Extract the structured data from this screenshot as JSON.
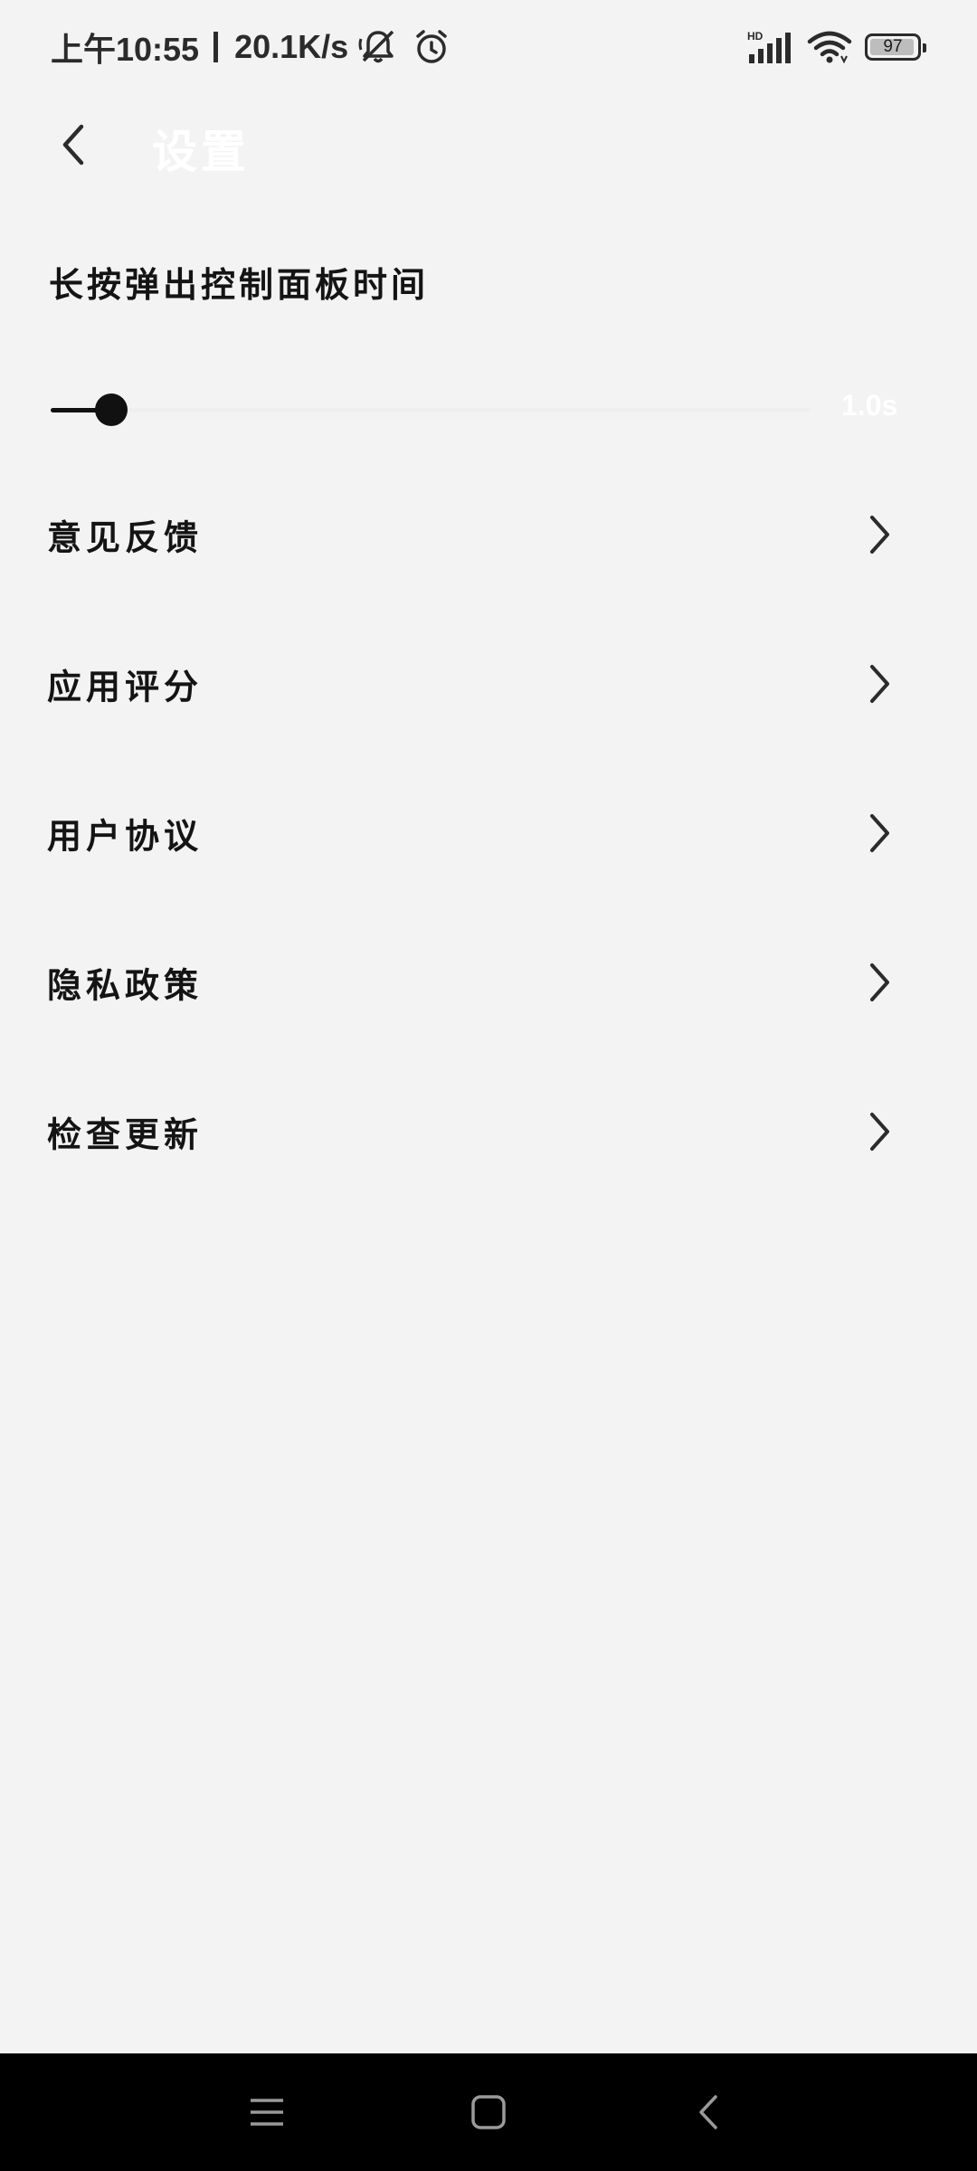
{
  "status_bar": {
    "time": "上午10:55",
    "network_speed": "20.1K/s",
    "icons": [
      "bell-muted-icon",
      "alarm-icon",
      "hd-signal-icon",
      "wifi-icon",
      "battery-icon"
    ],
    "hd_label": "HD",
    "battery_level": "97"
  },
  "app_bar": {
    "title": "设置",
    "back_icon": "chevron-left-icon"
  },
  "long_press": {
    "title": "长按弹出控制面板时间",
    "value_label": "1.0s",
    "slider_fraction": 0.08
  },
  "menu": {
    "items": [
      {
        "label": "意见反馈",
        "icon": "chevron-right-icon"
      },
      {
        "label": "应用评分",
        "icon": "chevron-right-icon"
      },
      {
        "label": "用户协议",
        "icon": "chevron-right-icon"
      },
      {
        "label": "隐私政策",
        "icon": "chevron-right-icon"
      },
      {
        "label": "检查更新",
        "icon": "chevron-right-icon"
      }
    ]
  },
  "nav_bar": {
    "icons": [
      "menu-icon",
      "home-icon",
      "back-icon"
    ]
  },
  "colors": {
    "background": "#f3f3f3",
    "text": "#141414",
    "slider_active": "#111111",
    "nav_bar": "#000000"
  }
}
